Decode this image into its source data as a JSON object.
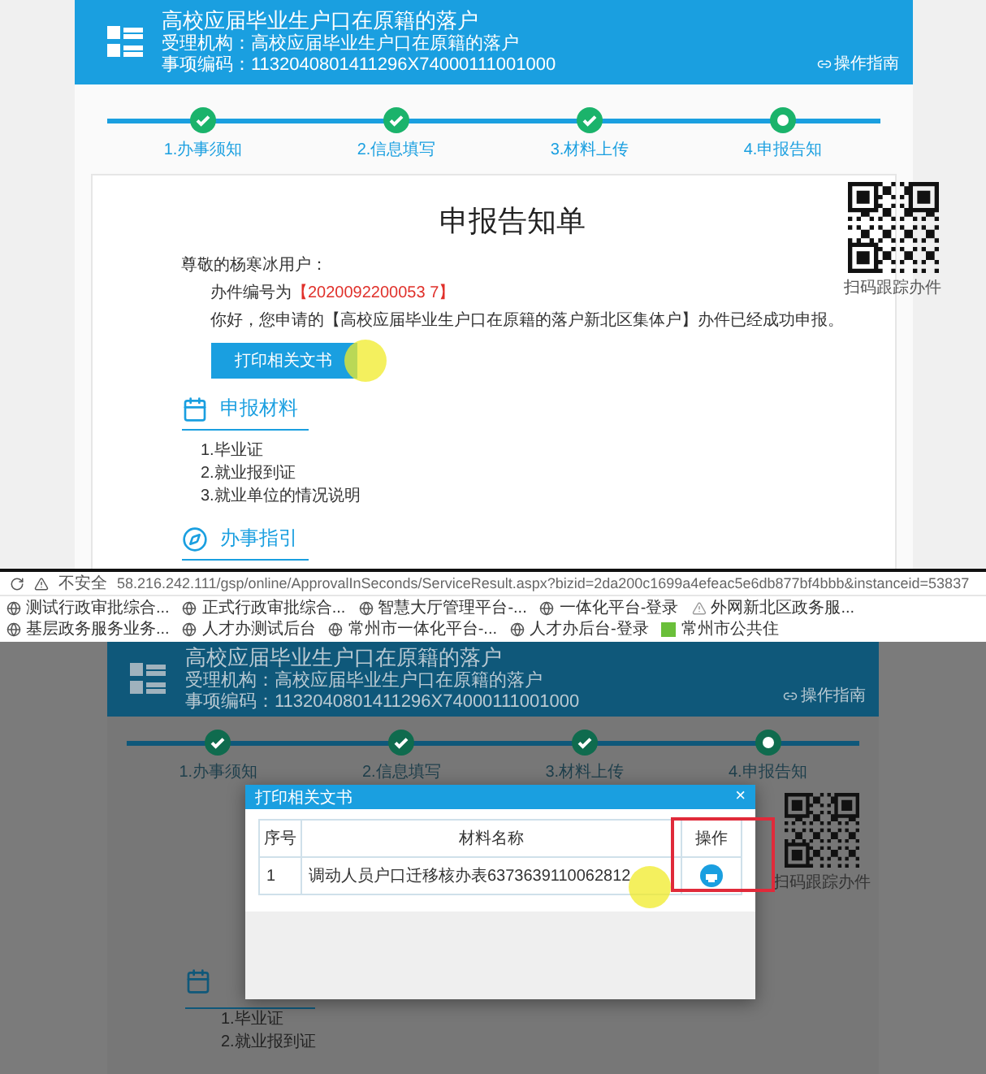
{
  "top": {
    "header": {
      "title": "高校应届毕业生户口在原籍的落户",
      "agency": "受理机构：高校应届毕业生户口在原籍的落户",
      "code": "事项编码：1132040801411296X74000111001000",
      "guide": "操作指南"
    },
    "steps": [
      {
        "label": "1.办事须知",
        "done": true
      },
      {
        "label": "2.信息填写",
        "done": true
      },
      {
        "label": "3.材料上传",
        "done": true
      },
      {
        "label": "4.申报告知",
        "done": false
      }
    ],
    "notice": {
      "title": "申报告知单",
      "greeting": "尊敬的杨寒冰用户：",
      "case_label": "办件编号为",
      "case_number": "【2020092200053 7】",
      "message": "你好，您申请的【高校应届毕业生户口在原籍的落户新北区集体户】办件已经成功申报。",
      "print_button": "打印相关文书",
      "qr_caption": "扫码跟踪办件",
      "sections": [
        {
          "kind": "calendar",
          "heading": "申报材料",
          "items": [
            "1.毕业证",
            "2.就业报到证",
            "3.就业单位的情况说明"
          ]
        },
        {
          "kind": "compass",
          "heading": "办事指引"
        }
      ]
    }
  },
  "browser": {
    "security": "不安全",
    "url": "58.216.242.111/gsp/online/ApprovalInSeconds/ServiceResult.aspx?bizid=2da200c1699a4efeac5e6db877bf4bbb&instanceid=53837",
    "bookmarks": [
      {
        "label": "测试行政审批综合...",
        "kind": "globe"
      },
      {
        "label": "正式行政审批综合...",
        "kind": "globe"
      },
      {
        "label": "智慧大厅管理平台-...",
        "kind": "globe"
      },
      {
        "label": "一体化平台-登录",
        "kind": "globe"
      },
      {
        "label": "外网新北区政务服...",
        "kind": "triangle"
      },
      {
        "label": "基层政务服务业务...",
        "kind": "globe"
      },
      {
        "label": "人才办测试后台",
        "kind": "globe"
      },
      {
        "label": "常州市一体化平台-...",
        "kind": "globe"
      },
      {
        "label": "人才办后台-登录",
        "kind": "globe"
      },
      {
        "label": "常州市公共住",
        "kind": "square"
      }
    ]
  },
  "bottom": {
    "header": {
      "title": "高校应届毕业生户口在原籍的落户",
      "agency": "受理机构：高校应届毕业生户口在原籍的落户",
      "code": "事项编码：1132040801411296X74000111001000",
      "guide": "操作指南"
    },
    "steps": [
      {
        "label": "1.办事须知",
        "done": true
      },
      {
        "label": "2.信息填写",
        "done": true
      },
      {
        "label": "3.材料上传",
        "done": true
      },
      {
        "label": "4.申报告知",
        "done": false
      }
    ],
    "qr_caption": "扫码跟踪办件",
    "materials": [
      "1.毕业证",
      "2.就业报到证"
    ],
    "dialog": {
      "title": "打印相关文书",
      "close": "×",
      "columns": [
        "序号",
        "材料名称",
        "操作"
      ],
      "rows": [
        {
          "index": "1",
          "name": "调动人员户口迁移核办表6373639110062812"
        }
      ]
    }
  }
}
